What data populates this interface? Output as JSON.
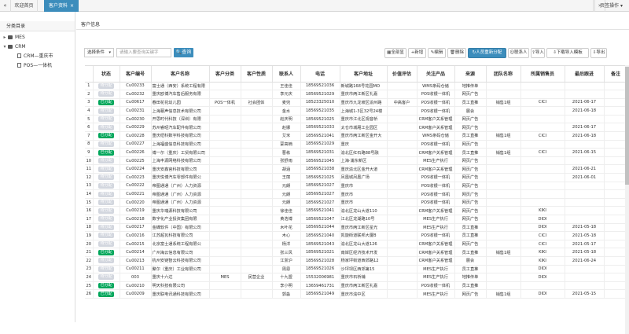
{
  "topbar": {
    "home_tab": "欢迎首页",
    "active_tab": "客户资料",
    "close": "×",
    "page_ops": "页签操作"
  },
  "sidebar": {
    "title": "分类目录",
    "nodes": [
      {
        "label": "MES",
        "type": "folder",
        "toggle": "▸",
        "indent": 0
      },
      {
        "label": "CRM",
        "type": "folder",
        "toggle": "▾",
        "indent": 0
      },
      {
        "label": "CRM—重庆市",
        "type": "file",
        "toggle": "",
        "indent": 1
      },
      {
        "label": "POS—一体机",
        "type": "file",
        "toggle": "",
        "indent": 1
      }
    ]
  },
  "main": {
    "section_title": "客户信息"
  },
  "filter": {
    "select_value": "选择条件",
    "keyword_placeholder": "请输入要查询关键字",
    "query_button": "查询"
  },
  "toolbar": [
    {
      "label": "全部显",
      "name": "show-all-button",
      "icon": "▦"
    },
    {
      "label": "新增",
      "name": "add-button",
      "icon": "+"
    },
    {
      "label": "编辑",
      "name": "edit-button",
      "icon": "✎"
    },
    {
      "label": "删除",
      "name": "delete-button",
      "icon": "🗑"
    },
    {
      "label": "人员重新分配",
      "name": "reassign-button",
      "icon": "↻"
    },
    {
      "label": "联系人",
      "name": "contacts-button",
      "icon": "☺"
    },
    {
      "label": "导入",
      "name": "import-button",
      "icon": "⇪"
    },
    {
      "label": "下载导入模板",
      "name": "download-template-button",
      "icon": "⇩"
    },
    {
      "label": "导出",
      "name": "export-button",
      "icon": "⇩"
    }
  ],
  "columns": [
    "",
    "状态",
    "客户编号",
    "客户名称",
    "客户分类",
    "客户性质",
    "联系人",
    "电话",
    "客户地址",
    "价值评估",
    "关注产品",
    "来源",
    "团队名称",
    "所属销售员",
    "最后跟进",
    "备注"
  ],
  "rows": [
    [
      "1",
      "gray",
      "Cu00233",
      "富士通（西安）系统工程有限",
      "",
      "",
      "王佳佳",
      "18569521036",
      "新城路168号花园MO",
      "",
      "WMS条码仓储",
      "地推传单",
      "",
      "",
      "",
      ""
    ],
    [
      "2",
      "gray",
      "Cu00232",
      "重庆欧博汽车售后服务有限",
      "",
      "",
      "李元庆",
      "18569521029",
      "重庆市两江新区礼嘉",
      "",
      "POS收银一体机",
      "网页广告",
      "",
      "",
      "",
      ""
    ],
    [
      "3",
      "green",
      "Cu00617",
      "春田花花幼儿园",
      "POS一体机",
      "社会团体",
      "麦兜",
      "18523325010",
      "重庆市九龙坡区渝州路",
      "中高客户",
      "POS收银一体机",
      "员工直推",
      "销售1组",
      "CICI",
      "2021-06-17",
      ""
    ],
    [
      "4",
      "gray",
      "Cu00231",
      "上海幕声信息技术有限公司",
      "",
      "",
      "金水",
      "18569521035",
      "上海城1-3区32号24楼",
      "",
      "POS收银一体机",
      "展会",
      "",
      "",
      "2021-06-18",
      ""
    ],
    [
      "5",
      "gray",
      "Cu00230",
      "开思时代科技（深圳）有限",
      "",
      "",
      "赵庆明",
      "18569521025",
      "重庆市江北区观音桥",
      "",
      "CRM客户关系管理",
      "网页广告",
      "",
      "",
      "",
      ""
    ],
    [
      "6",
      "gray",
      "Cu00229",
      "苏州睿昭汽车配件有限公司",
      "",
      "",
      "赵娜",
      "18569521033",
      "太仓市城厢工业园区",
      "",
      "CRM客户关系管理",
      "网页广告",
      "",
      "",
      "2021-06-17",
      ""
    ],
    [
      "7",
      "green",
      "Cu00228",
      "重庆纽科数字科技有限公司",
      "",
      "",
      "艾米",
      "18569521041",
      "重庆市两江新区金开大",
      "",
      "WMS条码仓储",
      "员工直推",
      "销售1组",
      "CICI",
      "2021-06-18",
      ""
    ],
    [
      "8",
      "gray",
      "Cu00227",
      "上海福盛信息科技有限公司",
      "",
      "",
      "蒙高楠",
      "18569521029",
      "重庆",
      "",
      "POS收银一体机",
      "网页广告",
      "",
      "",
      "",
      ""
    ],
    [
      "9",
      "green",
      "Cu00226",
      "博一尔（重庆）工贸有限公司",
      "",
      "",
      "曹栋",
      "18569521031",
      "渝北区红石路88号融",
      "",
      "CRM客户关系管理",
      "员工直推",
      "销售1组",
      "CICI",
      "2021-06-15",
      ""
    ],
    [
      "10",
      "gray",
      "Cu00225",
      "上海丰源网络科技有限公司",
      "",
      "",
      "张舒雨",
      "18569521045",
      "上海·浦东新区",
      "",
      "MES生产执行",
      "网页广告",
      "",
      "",
      "",
      ""
    ],
    [
      "11",
      "gray",
      "Cu00224",
      "重庆安鑫宫科技有限公司",
      "",
      "",
      "胡涵",
      "18569521038",
      "重庆渝北区金开大道",
      "",
      "CRM客户关系管理",
      "网页广告",
      "",
      "",
      "2021-06-21",
      ""
    ],
    [
      "12",
      "gray",
      "Cu00223",
      "重庆悦博汽车零部件有限公",
      "",
      "",
      "王丽",
      "18569521025",
      "凤凰城凤凰广场",
      "",
      "POS收银一体机",
      "网页广告",
      "",
      "",
      "2021-06-01",
      ""
    ],
    [
      "13",
      "gray",
      "Cu00222",
      "帝图通通（广州）人力资源",
      "",
      "",
      "元朗",
      "18569521027",
      "重庆市",
      "",
      "POS收银一体机",
      "网页广告",
      "",
      "",
      "",
      ""
    ],
    [
      "14",
      "gray",
      "Cu00221",
      "帝图通通（广州）人力资源",
      "",
      "",
      "元朗",
      "18569521027",
      "重庆市",
      "",
      "POS收银一体机",
      "网页广告",
      "",
      "",
      "",
      ""
    ],
    [
      "15",
      "gray",
      "Cu00220",
      "帝图通通（广州）人力资源",
      "",
      "",
      "元朗",
      "18569521027",
      "重庆市",
      "",
      "POS收银一体机",
      "网页广告",
      "",
      "",
      "",
      ""
    ],
    [
      "16",
      "gray",
      "Cu00219",
      "重庆华瑞源科技有限公司",
      "",
      "",
      "徐佳佳",
      "18569521041",
      "渝北区龙山大道110",
      "",
      "CRM客户关系管理",
      "网页广告",
      "",
      "KIKI",
      "",
      ""
    ],
    [
      "17",
      "gray",
      "Cu00218",
      "数字化产业投资集团有限",
      "",
      "",
      "黄浩博",
      "18569521047",
      "江北区龙湖路10号",
      "",
      "MES生产执行",
      "网页广告",
      "",
      "DIDI",
      "",
      ""
    ],
    [
      "18",
      "gray",
      "Cu00217",
      "金蝶软件（中国）有限公司",
      "",
      "",
      "木叶花",
      "18569521044",
      "重庆市两江新区星光",
      "",
      "MES生产执行",
      "员工直推",
      "",
      "DIDI",
      "2021-05-18",
      ""
    ],
    [
      "19",
      "gray",
      "Cu00216",
      "江苏超瓦科技有限公司",
      "",
      "",
      "木心",
      "18569521040",
      "凯旋街道联邦大厦B",
      "",
      "POS收银一体机",
      "员工直推",
      "",
      "CICI",
      "2021-05-18",
      ""
    ],
    [
      "20",
      "gray",
      "Cu00215",
      "北京富士通系统工程有限公",
      "",
      "",
      "杨洋",
      "18569521043",
      "渝北区龙山大道126",
      "",
      "CRM客户关系管理",
      "网页广告",
      "",
      "CICI",
      "2021-05-17",
      ""
    ],
    [
      "21",
      "green",
      "Cu00214",
      "广州海云信息有限公司",
      "",
      "",
      "张三风",
      "18569521021",
      "南岸区经济技术开发",
      "",
      "CRM客户关系管理",
      "员工直推",
      "销售1组",
      "KIKI",
      "2021-05-18",
      ""
    ],
    [
      "22",
      "gray",
      "Cu00213",
      "杭州安链智云科技有限公司",
      "",
      "",
      "江浙沪",
      "18569521028",
      "杨家坪街道西郊路12",
      "",
      "CRM客户关系管理",
      "展会",
      "",
      "KIKI",
      "2021-06-24",
      ""
    ],
    [
      "23",
      "gray",
      "Cu00211",
      "聚尔（重庆）工业有限公司",
      "",
      "",
      "周恩",
      "18569521026",
      "沙坪坝区西郊第15",
      "",
      "MES生产执行",
      "员工直推",
      "",
      "DIDI",
      "",
      ""
    ],
    [
      "24",
      "gray",
      "003",
      "重庆十六达",
      "MES",
      "民营企业",
      "十九盟",
      "15532006981",
      "重庆市石桥铺",
      "",
      "MES生产执行",
      "地推传单",
      "",
      "DIDI",
      "",
      ""
    ],
    [
      "25",
      "green",
      "Cu00210",
      "明天科技有限公司",
      "",
      "",
      "李小明",
      "13659461731",
      "重庆市两江新区礼嘉",
      "",
      "POS收银一体机",
      "员工直推",
      "",
      "",
      "",
      ""
    ],
    [
      "26",
      "green",
      "Cu00209",
      "重庆联电讯通科技有限公司",
      "",
      "",
      "郭淼",
      "18569521049",
      "重庆市渝中区",
      "",
      "MES生产执行",
      "网页广告",
      "销售1组",
      "DIDI",
      "2021-05-15",
      ""
    ]
  ],
  "status_labels": {
    "gray": "待分配",
    "green": "已分配"
  },
  "colors": {
    "accent": "#3c8dbc",
    "assigned": "#00a65a",
    "unassigned": "#d2d6de"
  }
}
